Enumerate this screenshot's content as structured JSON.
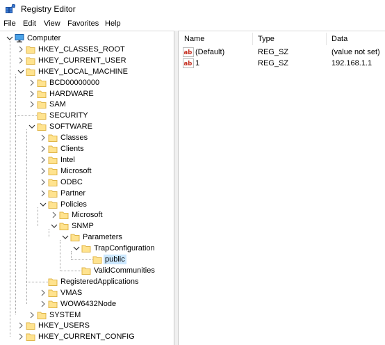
{
  "window": {
    "title": "Registry Editor"
  },
  "menu": [
    "File",
    "Edit",
    "View",
    "Favorites",
    "Help"
  ],
  "tree": [
    {
      "label": "Computer",
      "level": 0,
      "state": "expanded",
      "icon": "computer-icon"
    },
    {
      "label": "HKEY_CLASSES_ROOT",
      "level": 1,
      "state": "collapsed",
      "icon": "folder-icon"
    },
    {
      "label": "HKEY_CURRENT_USER",
      "level": 1,
      "state": "collapsed",
      "icon": "folder-icon"
    },
    {
      "label": "HKEY_LOCAL_MACHINE",
      "level": 1,
      "state": "expanded",
      "icon": "folder-icon"
    },
    {
      "label": "BCD00000000",
      "level": 2,
      "state": "collapsed",
      "icon": "folder-icon"
    },
    {
      "label": "HARDWARE",
      "level": 2,
      "state": "collapsed",
      "icon": "folder-icon"
    },
    {
      "label": "SAM",
      "level": 2,
      "state": "collapsed",
      "icon": "folder-icon"
    },
    {
      "label": "SECURITY",
      "level": 2,
      "state": "leaf",
      "icon": "folder-icon"
    },
    {
      "label": "SOFTWARE",
      "level": 2,
      "state": "expanded",
      "icon": "folder-icon"
    },
    {
      "label": "Classes",
      "level": 3,
      "state": "collapsed",
      "icon": "folder-icon"
    },
    {
      "label": "Clients",
      "level": 3,
      "state": "collapsed",
      "icon": "folder-icon"
    },
    {
      "label": "Intel",
      "level": 3,
      "state": "collapsed",
      "icon": "folder-icon"
    },
    {
      "label": "Microsoft",
      "level": 3,
      "state": "collapsed",
      "icon": "folder-icon"
    },
    {
      "label": "ODBC",
      "level": 3,
      "state": "collapsed",
      "icon": "folder-icon"
    },
    {
      "label": "Partner",
      "level": 3,
      "state": "collapsed",
      "icon": "folder-icon"
    },
    {
      "label": "Policies",
      "level": 3,
      "state": "expanded",
      "icon": "folder-icon"
    },
    {
      "label": "Microsoft",
      "level": 4,
      "state": "collapsed",
      "icon": "folder-icon"
    },
    {
      "label": "SNMP",
      "level": 4,
      "state": "expanded",
      "icon": "folder-icon"
    },
    {
      "label": "Parameters",
      "level": 5,
      "state": "expanded",
      "icon": "folder-icon"
    },
    {
      "label": "TrapConfiguration",
      "level": 6,
      "state": "expanded",
      "icon": "folder-icon"
    },
    {
      "label": "public",
      "level": 7,
      "state": "leaf",
      "icon": "folder-icon",
      "selected": true
    },
    {
      "label": "ValidCommunities",
      "level": 6,
      "state": "leaf",
      "icon": "folder-icon"
    },
    {
      "label": "RegisteredApplications",
      "level": 3,
      "state": "leaf",
      "icon": "folder-icon"
    },
    {
      "label": "VMAS",
      "level": 3,
      "state": "collapsed",
      "icon": "folder-icon"
    },
    {
      "label": "WOW6432Node",
      "level": 3,
      "state": "collapsed",
      "icon": "folder-icon"
    },
    {
      "label": "SYSTEM",
      "level": 2,
      "state": "collapsed",
      "icon": "folder-icon"
    },
    {
      "label": "HKEY_USERS",
      "level": 1,
      "state": "collapsed",
      "icon": "folder-icon"
    },
    {
      "label": "HKEY_CURRENT_CONFIG",
      "level": 1,
      "state": "collapsed",
      "icon": "folder-icon"
    }
  ],
  "values": {
    "headers": {
      "name": "Name",
      "type": "Type",
      "data": "Data"
    },
    "rows": [
      {
        "name": "(Default)",
        "type": "REG_SZ",
        "data": "(value not set)",
        "icon": "string-value-icon"
      },
      {
        "name": "1",
        "type": "REG_SZ",
        "data": "192.168.1.1",
        "icon": "string-value-icon"
      }
    ]
  },
  "colors": {
    "selection": "#cce8ff",
    "folder_fill": "#ffe38f",
    "folder_edge": "#e0b64a",
    "value_icon_red": "#c42b1c"
  }
}
